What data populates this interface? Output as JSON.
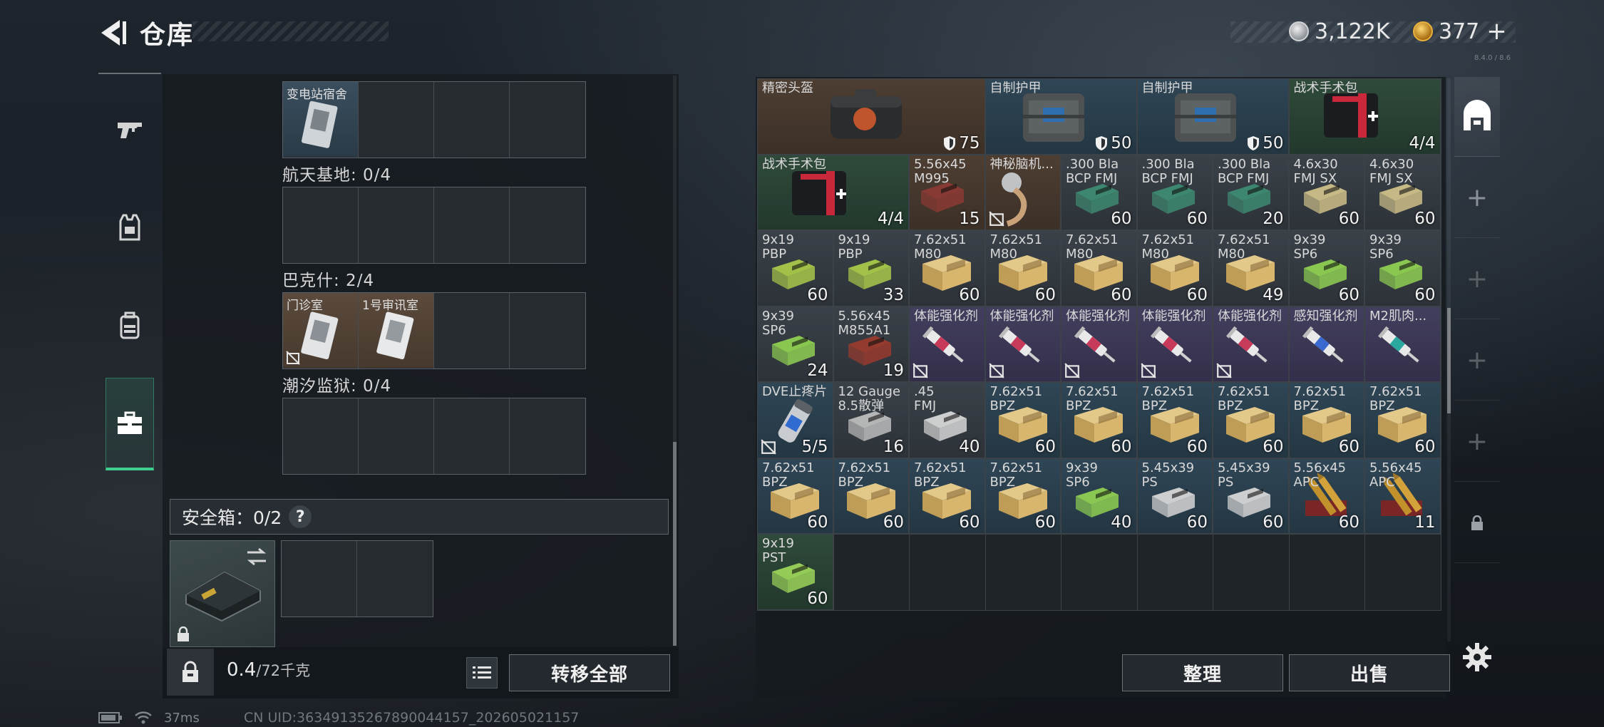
{
  "header": {
    "title": "仓库",
    "currency_silver": "3,122K",
    "currency_gold": "377",
    "gold_plus": "+",
    "version": "8.4.0 / 8.6"
  },
  "nav": {
    "items": [
      "weapons-tab",
      "gear-tab",
      "backpack-tab",
      "storage-tab"
    ],
    "active": "storage-tab"
  },
  "containers": {
    "top_card_name": "变电站宿舍",
    "sections": [
      {
        "label": "航天基地: 0/4"
      },
      {
        "label": "巴克什: 2/4",
        "cards": [
          "门诊室",
          "1号审讯室"
        ]
      },
      {
        "label": "潮汐监狱: 0/4"
      }
    ]
  },
  "safe": {
    "label": "安全箱：0/2",
    "help": "?"
  },
  "footer_left": {
    "weight_value": "0.4",
    "weight_unit": "/72千克",
    "transfer_all": "转移全部"
  },
  "actions": {
    "organize": "整理",
    "sell": "出售"
  },
  "status": {
    "ping": "37ms",
    "uid": "CN UID:3634913526789004415​7_202605021157"
  },
  "inventory": {
    "row1": [
      {
        "name": "精密头盔",
        "value": "75"
      },
      {
        "name": "自制护甲",
        "value": "50"
      },
      {
        "name": "自制护甲",
        "value": "50"
      },
      {
        "name": "战术手术包",
        "value": "4/4"
      }
    ],
    "row2": [
      {
        "name": "战术手术包",
        "qty": "4/4"
      },
      {
        "name": "5.56x45",
        "sub": "M995",
        "qty": "15"
      },
      {
        "name": "神秘脑机...",
        "qty": ""
      },
      {
        "name": ".300 Bla",
        "sub": "BCP FMJ",
        "qty": "60"
      },
      {
        "name": ".300 Bla",
        "sub": "BCP FMJ",
        "qty": "60"
      },
      {
        "name": ".300 Bla",
        "sub": "BCP FMJ",
        "qty": "20"
      },
      {
        "name": "4.6x30",
        "sub": "FMJ SX",
        "qty": "60"
      },
      {
        "name": "4.6x30",
        "sub": "FMJ SX",
        "qty": "60"
      }
    ],
    "row3": [
      {
        "name": "9x19",
        "sub": "PBP",
        "qty": "60"
      },
      {
        "name": "9x19",
        "sub": "PBP",
        "qty": "33"
      },
      {
        "name": "7.62x51",
        "sub": "M80",
        "qty": "60"
      },
      {
        "name": "7.62x51",
        "sub": "M80",
        "qty": "60"
      },
      {
        "name": "7.62x51",
        "sub": "M80",
        "qty": "60"
      },
      {
        "name": "7.62x51",
        "sub": "M80",
        "qty": "60"
      },
      {
        "name": "7.62x51",
        "sub": "M80",
        "qty": "49"
      },
      {
        "name": "9x39",
        "sub": "SP6",
        "qty": "60"
      },
      {
        "name": "9x39",
        "sub": "SP6",
        "qty": "60"
      }
    ],
    "row4": [
      {
        "name": "9x39",
        "sub": "SP6",
        "qty": "24"
      },
      {
        "name": "5.56x45",
        "sub": "M855A1",
        "qty": "19"
      },
      {
        "name": "体能强化剂",
        "qty": ""
      },
      {
        "name": "体能强化剂",
        "qty": ""
      },
      {
        "name": "体能强化剂",
        "qty": ""
      },
      {
        "name": "体能强化剂",
        "qty": ""
      },
      {
        "name": "体能强化剂",
        "qty": ""
      },
      {
        "name": "感知强化剂",
        "qty": ""
      },
      {
        "name": "M2肌肉...",
        "qty": ""
      }
    ],
    "row5": [
      {
        "name": "DVE止疼片",
        "qty": "5/5"
      },
      {
        "name": "12 Gauge",
        "sub": "8.5散弹",
        "qty": "16"
      },
      {
        "name": ".45",
        "sub": "FMJ",
        "qty": "40"
      },
      {
        "name": "7.62x51",
        "sub": "BPZ",
        "qty": "60"
      },
      {
        "name": "7.62x51",
        "sub": "BPZ",
        "qty": "60"
      },
      {
        "name": "7.62x51",
        "sub": "BPZ",
        "qty": "60"
      },
      {
        "name": "7.62x51",
        "sub": "BPZ",
        "qty": "60"
      },
      {
        "name": "7.62x51",
        "sub": "BPZ",
        "qty": "60"
      },
      {
        "name": "7.62x51",
        "sub": "BPZ",
        "qty": "60"
      }
    ],
    "row6": [
      {
        "name": "7.62x51",
        "sub": "BPZ",
        "qty": "60"
      },
      {
        "name": "7.62x51",
        "sub": "BPZ",
        "qty": "60"
      },
      {
        "name": "7.62x51",
        "sub": "BPZ",
        "qty": "60"
      },
      {
        "name": "7.62x51",
        "sub": "BPZ",
        "qty": "60"
      },
      {
        "name": "9x39",
        "sub": "SP6",
        "qty": "40"
      },
      {
        "name": "5.45x39",
        "sub": "PS",
        "qty": "60"
      },
      {
        "name": "5.45x39",
        "sub": "PS",
        "qty": "60"
      },
      {
        "name": "5.56x45",
        "sub": "APC",
        "qty": "60"
      },
      {
        "name": "5.56x45",
        "sub": "APC",
        "qty": "11"
      }
    ],
    "row7": [
      {
        "name": "9x19",
        "sub": "PST",
        "qty": "60"
      }
    ]
  }
}
